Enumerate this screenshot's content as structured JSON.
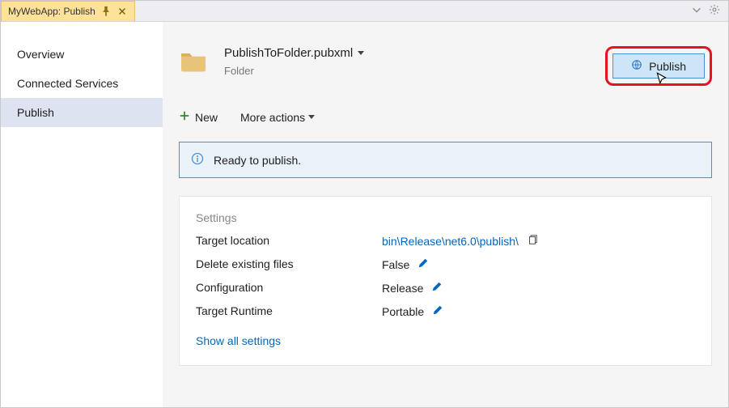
{
  "titlebar": {
    "tab_label": "MyWebApp: Publish"
  },
  "sidebar": {
    "items": [
      {
        "label": "Overview"
      },
      {
        "label": "Connected Services"
      },
      {
        "label": "Publish"
      }
    ]
  },
  "profile": {
    "name": "PublishToFolder.pubxml",
    "type": "Folder"
  },
  "publish_button_label": "Publish",
  "actions": {
    "new_label": "New",
    "more_label": "More actions"
  },
  "status": {
    "message": "Ready to publish."
  },
  "settings": {
    "heading": "Settings",
    "rows": {
      "target_location": {
        "label": "Target location",
        "value": "bin\\Release\\net6.0\\publish\\"
      },
      "delete_existing": {
        "label": "Delete existing files",
        "value": "False"
      },
      "configuration": {
        "label": "Configuration",
        "value": "Release"
      },
      "target_runtime": {
        "label": "Target Runtime",
        "value": "Portable"
      }
    },
    "show_all_label": "Show all settings"
  },
  "colors": {
    "accent": "#4a90d9",
    "highlight": "#e81123",
    "link": "#0066c0"
  }
}
